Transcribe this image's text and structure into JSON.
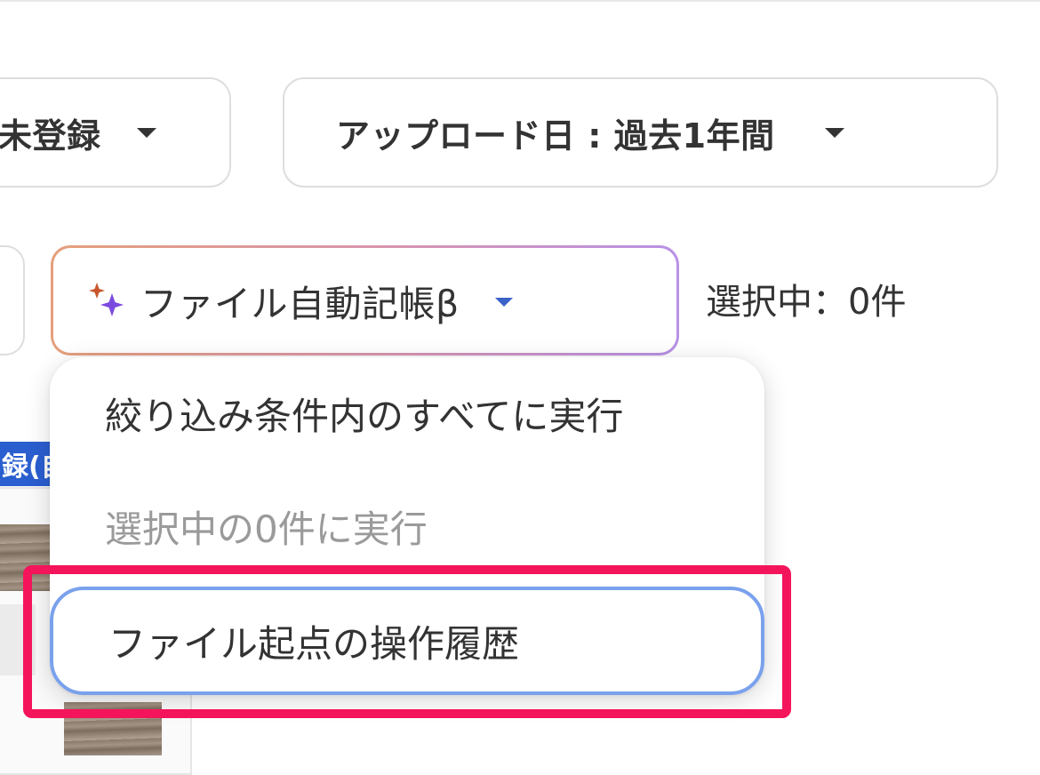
{
  "filters": {
    "registration_label": "未登録",
    "upload_label": "アップロード日 : 過去1年間"
  },
  "actions": {
    "auto_bookkeeping_label": "ファイル自動記帳β",
    "selection_count": "選択中：0件"
  },
  "card": {
    "tag_label": "録(自"
  },
  "menu": {
    "items": [
      {
        "label": "絞り込み条件内のすべてに実行",
        "enabled": true
      },
      {
        "label": "選択中の0件に実行",
        "enabled": false
      },
      {
        "label": "ファイル起点の操作履歴",
        "enabled": true,
        "focused": true
      }
    ]
  },
  "colors": {
    "accent_blue": "#2b5fd0",
    "focus_ring": "#7aa1ec",
    "annotation": "#f4145c",
    "disabled_text": "#9a9a9a"
  },
  "icons": {
    "sparkle": "sparkle-icon",
    "caret": "chevron-down-icon"
  }
}
